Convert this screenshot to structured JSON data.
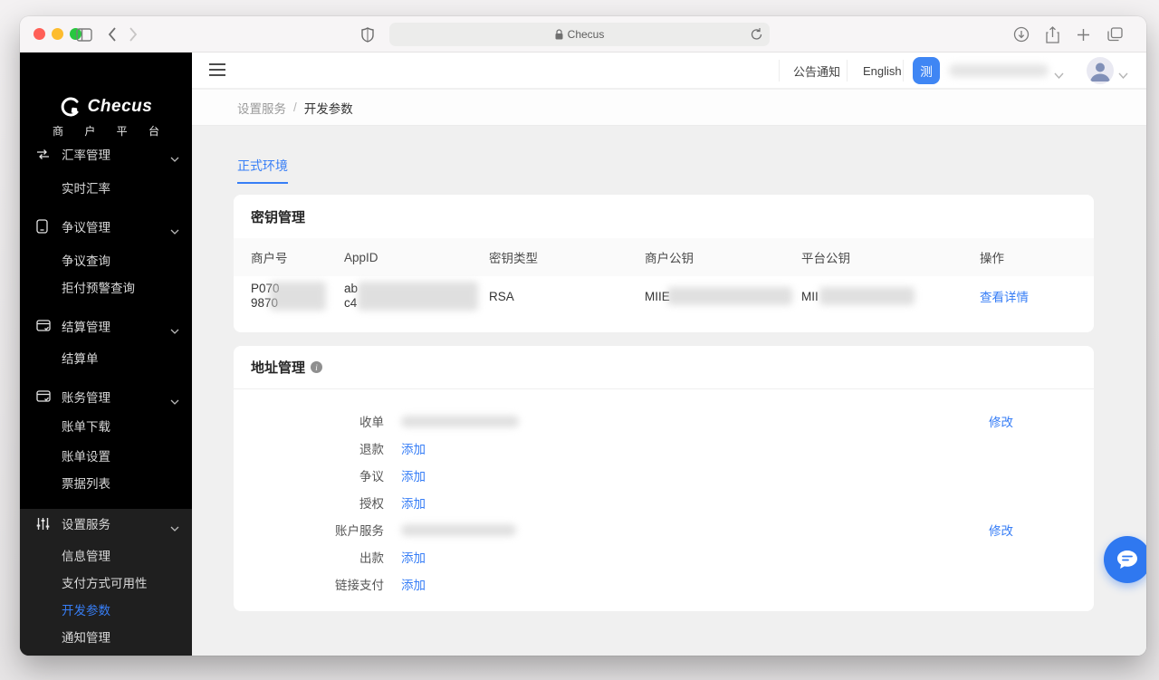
{
  "colors": {
    "accent": "#377ef6",
    "env_badge": "#3f86f4",
    "chat_fab": "#2f78f0",
    "sidebar_bg": "#000000",
    "sidebar_group_bg": "#1f1f1f",
    "content_bg": "#f0f0f0"
  },
  "browser": {
    "address_text": "Checus"
  },
  "brand": {
    "name": "Checus",
    "subtitle": "商 户 平 台"
  },
  "app_header": {
    "announcements": "公告通知",
    "language": "English",
    "env_badge": "测"
  },
  "sidebar": {
    "items": [
      {
        "label": "汇率管理"
      },
      {
        "label": "实时汇率"
      },
      {
        "label": "争议管理"
      },
      {
        "label": "争议查询"
      },
      {
        "label": "拒付预警查询"
      },
      {
        "label": "结算管理"
      },
      {
        "label": "结算单"
      },
      {
        "label": "账务管理"
      },
      {
        "label": "账单下载"
      },
      {
        "label": "账单设置"
      },
      {
        "label": "票据列表"
      },
      {
        "label": "设置服务"
      },
      {
        "label": "信息管理"
      },
      {
        "label": "支付方式可用性"
      },
      {
        "label": "开发参数"
      },
      {
        "label": "通知管理"
      }
    ]
  },
  "breadcrumb": {
    "section": "设置服务",
    "separator": "/",
    "page": "开发参数"
  },
  "tabs": {
    "production": "正式环境"
  },
  "key_management": {
    "title": "密钥管理",
    "columns": [
      "商户号",
      "AppID",
      "密钥类型",
      "商户公钥",
      "平台公钥",
      "操作"
    ],
    "row": {
      "merchant_no_l1": "P070",
      "merchant_no_l2": "9870",
      "appid_l1": "ab",
      "appid_l2": "c4",
      "key_type": "RSA",
      "merchant_public_key_prefix": "MIIE",
      "platform_public_key_prefix": "MII",
      "action": "查看详情"
    }
  },
  "address_management": {
    "title": "地址管理",
    "labels": {
      "acquiring": "收单",
      "refund": "退款",
      "dispute": "争议",
      "authorization": "授权",
      "account_service": "账户服务",
      "payout": "出款",
      "link_payment": "链接支付"
    },
    "add_link": "添加",
    "modify_link": "修改"
  }
}
